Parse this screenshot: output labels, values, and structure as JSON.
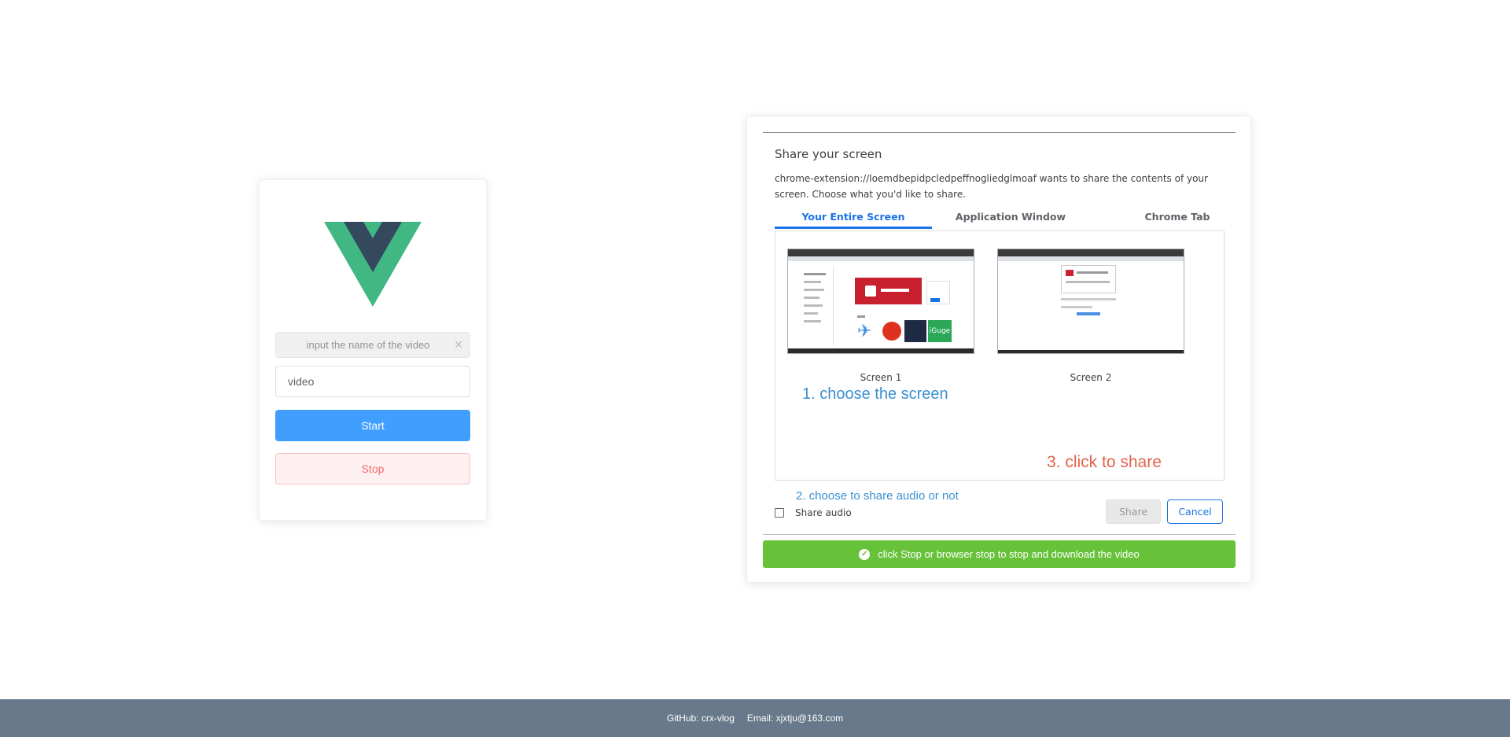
{
  "left": {
    "name_placeholder": "input the name of the video",
    "name_value": "video",
    "start_label": "Start",
    "stop_label": "Stop",
    "logo_colors": {
      "outer": "#41b883",
      "inner": "#34495e"
    }
  },
  "dialog": {
    "title": "Share your screen",
    "description": "chrome-extension://loemdbepidpcledpeffnogliedglmoaf wants to share the contents of your screen. Choose what you'd like to share.",
    "tabs": [
      {
        "label": "Your Entire Screen",
        "active": true
      },
      {
        "label": "Application Window",
        "active": false
      },
      {
        "label": "Chrome Tab",
        "active": false
      }
    ],
    "screens": [
      {
        "label": "Screen 1"
      },
      {
        "label": "Screen 2"
      }
    ],
    "annotations": {
      "step1": "1. choose the screen",
      "step2": "2. choose to share audio or not",
      "step3": "3. click to share"
    },
    "share_audio_label": "Share audio",
    "share_button": "Share",
    "cancel_button": "Cancel"
  },
  "status": {
    "message": "click Stop or browser stop to stop and download the video",
    "icon": "check-circle-icon",
    "color": "#67c23a"
  },
  "footer": {
    "github": "GitHub: crx-vlog",
    "email": "Email: xjxtju@163.com"
  },
  "colors": {
    "primary": "#409eff",
    "danger": "#f56c6c",
    "success": "#67c23a",
    "footer_bg": "#67798a"
  }
}
